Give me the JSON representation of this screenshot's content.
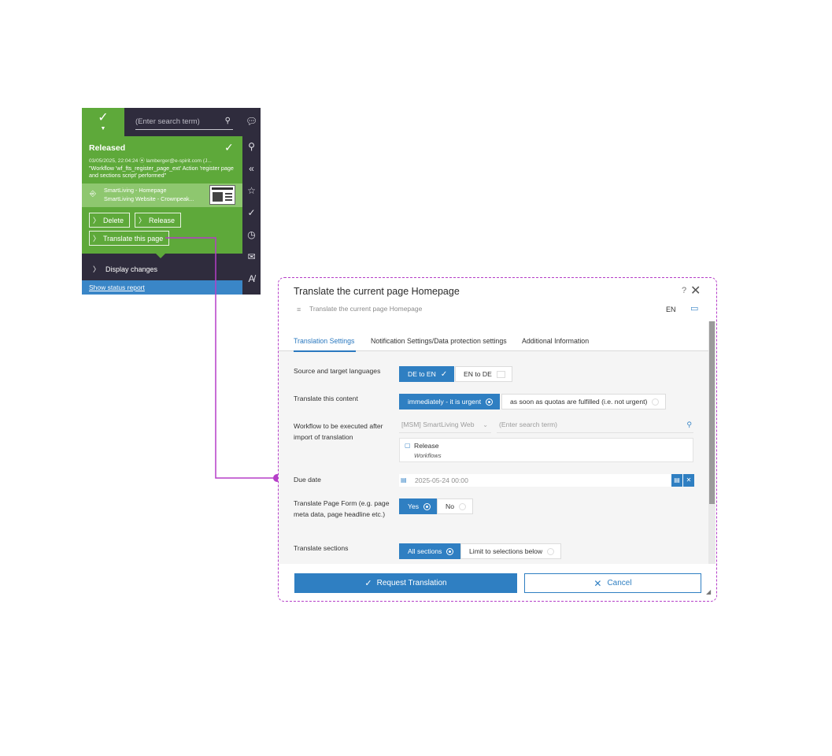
{
  "status_panel": {
    "search_placeholder": "(Enter search term)",
    "state": "Released",
    "meta": "03/05/2025, 22:04:24 ⦿ lamberger@e-spirit.com (J...",
    "workflow_message": "\"Workflow 'wf_fts_register_page_ext' Action 'register page and sections script' performed\"",
    "page_name": "SmartLiving - Homepage",
    "site_name": "SmartLiving Website - Crownpeak...",
    "delete_label": "Delete",
    "release_label": "Release",
    "translate_label": "Translate this page",
    "display_changes_label": "Display changes",
    "status_report_label": "Show status report",
    "colors": {
      "green": "#5ea93a",
      "dark": "#2f2c3d",
      "blue": "#3a86c7"
    },
    "rail_icons": [
      "comment-icon",
      "search-icon",
      "collapse-icon",
      "star-icon",
      "check-icon",
      "history-icon",
      "mail-icon",
      "spellcheck-icon"
    ]
  },
  "dialog": {
    "title": "Translate the current page Homepage",
    "help": "?",
    "subtitle": "Translate the current page Homepage",
    "language": "EN",
    "tabs": [
      "Translation Settings",
      "Notification Settings/Data protection settings",
      "Additional Information"
    ],
    "active_tab": 0,
    "rows": {
      "languages": {
        "label": "Source and target languages",
        "options": [
          "DE to EN",
          "EN to DE"
        ],
        "selected": 0
      },
      "translate_content": {
        "label": "Translate this content",
        "options": [
          "immediately - it is urgent",
          "as soon as quotas are fulfilled (i.e. not urgent)"
        ],
        "selected": 0
      },
      "workflow": {
        "label": "Workflow to be executed after import of translation",
        "project": "[MSM] SmartLiving Web",
        "search_placeholder": "(Enter search term)",
        "item_title": "Release",
        "item_subtitle": "Workflows"
      },
      "due_date": {
        "label": "Due date",
        "value": "2025-05-24 00:00"
      },
      "page_form": {
        "label": "Translate Page Form (e.g. page meta data, page headline etc.)",
        "options": [
          "Yes",
          "No"
        ],
        "selected": 0
      },
      "sections": {
        "label": "Translate sections",
        "options": [
          "All sections",
          "Limit to selections below"
        ],
        "selected": 0
      }
    },
    "request_label": "Request Translation",
    "cancel_label": "Cancel",
    "accent_color": "#2f7fc2",
    "highlight_color": "#b53ec8"
  }
}
